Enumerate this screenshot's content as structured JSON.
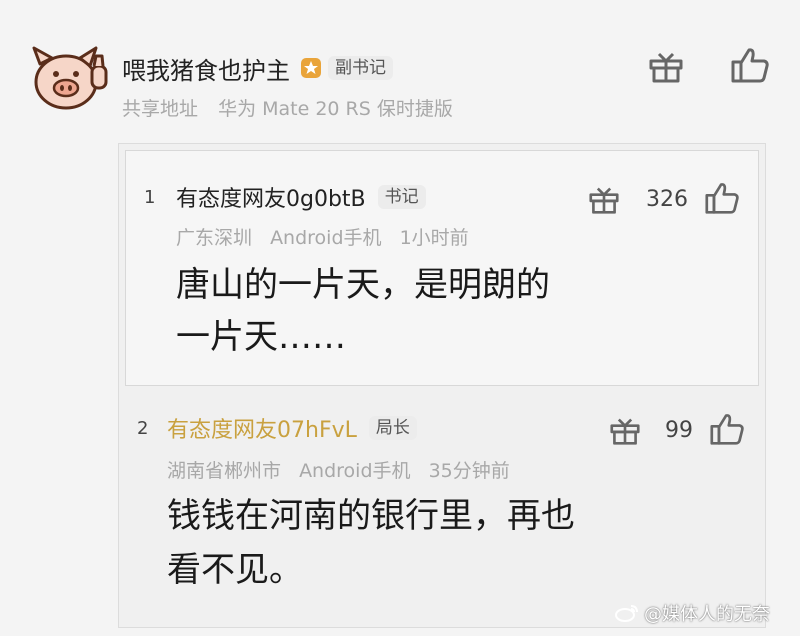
{
  "top_comment": {
    "user_name": "喂我猪食也护主",
    "badge": "副书记",
    "meta": [
      "共享地址",
      "华为 Mate 20 RS 保时捷版"
    ]
  },
  "replies": [
    {
      "index": "1",
      "user_name": "有态度网友0g0btB",
      "badge": "书记",
      "meta": [
        "广东深圳",
        "Android手机",
        "1小时前"
      ],
      "like_count": "326",
      "text_lines": [
        "唐山的一片天，是明朗的",
        "一片天……"
      ]
    },
    {
      "index": "2",
      "user_name": "有态度网友07hFvL",
      "badge": "局长",
      "meta": [
        "湖南省郴州市",
        "Android手机",
        "35分钟前"
      ],
      "like_count": "99",
      "text_lines": [
        "钱钱在河南的银行里，再也",
        "看不见。"
      ]
    }
  ],
  "watermark": "@媒体人的无奈",
  "colors": {
    "gold_name": "#c9a13f",
    "meta_gray": "#a8a8a8",
    "background": "#f4f4f4"
  },
  "icons": [
    "pig-avatar",
    "medal-icon",
    "gift-icon",
    "thumbs-up-icon",
    "weibo-icon"
  ]
}
